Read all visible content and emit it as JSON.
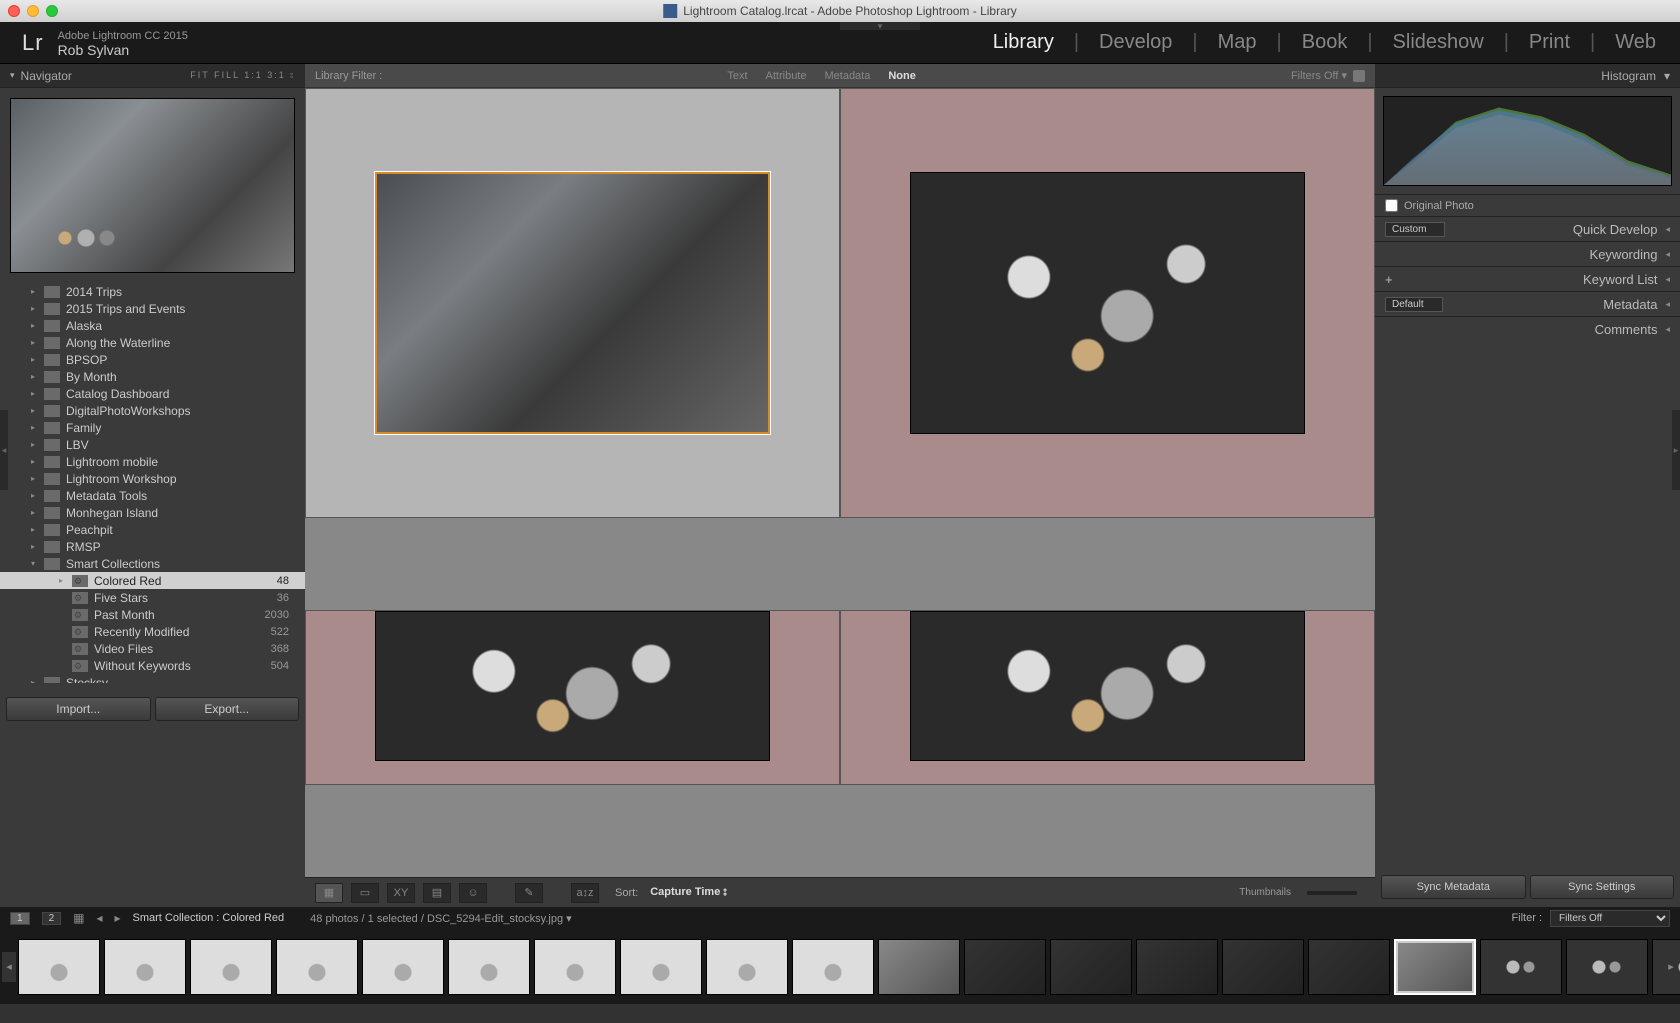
{
  "window": {
    "title": "Lightroom Catalog.lrcat - Adobe Photoshop Lightroom - Library"
  },
  "identity": {
    "product": "Adobe Lightroom CC 2015",
    "user": "Rob Sylvan",
    "logo": "Lr"
  },
  "modules": {
    "items": [
      "Library",
      "Develop",
      "Map",
      "Book",
      "Slideshow",
      "Print",
      "Web"
    ],
    "active": "Library"
  },
  "navigator": {
    "title": "Navigator",
    "zoom_modes": "FIT   FILL   1:1   3:1 ⦂"
  },
  "tree": {
    "items": [
      {
        "label": "2014 Trips"
      },
      {
        "label": "2015 Trips and Events"
      },
      {
        "label": "Alaska"
      },
      {
        "label": "Along the Waterline"
      },
      {
        "label": "BPSOP"
      },
      {
        "label": "By Month"
      },
      {
        "label": "Catalog Dashboard"
      },
      {
        "label": "DigitalPhotoWorkshops"
      },
      {
        "label": "Family"
      },
      {
        "label": "LBV"
      },
      {
        "label": "Lightroom mobile"
      },
      {
        "label": "Lightroom Workshop"
      },
      {
        "label": "Metadata Tools"
      },
      {
        "label": "Monhegan Island"
      },
      {
        "label": "Peachpit"
      },
      {
        "label": "RMSP"
      }
    ],
    "smart": {
      "label": "Smart Collections",
      "children": [
        {
          "label": "Colored Red",
          "count": "48",
          "selected": true
        },
        {
          "label": "Five Stars",
          "count": "36"
        },
        {
          "label": "Past Month",
          "count": "2030"
        },
        {
          "label": "Recently Modified",
          "count": "522"
        },
        {
          "label": "Video Files",
          "count": "368"
        },
        {
          "label": "Without Keywords",
          "count": "504"
        }
      ]
    },
    "last": {
      "label": "Stocksy"
    }
  },
  "impexp": {
    "import": "Import...",
    "export": "Export..."
  },
  "filterbar": {
    "label": "Library Filter :",
    "types": [
      "Text",
      "Attribute",
      "Metadata",
      "None"
    ],
    "active": "None",
    "filters_off": "Filters Off ▾"
  },
  "toolbar": {
    "sort_label": "Sort:",
    "sort_value": "Capture Time",
    "thumbnails": "Thumbnails"
  },
  "right": {
    "histogram": "Histogram",
    "original": "Original Photo",
    "quickdev_dd": "Custom",
    "quickdev": "Quick Develop",
    "keywording": "Keywording",
    "keywordlist": "Keyword List",
    "keywordlist_plus": "+",
    "metadata_dd": "Default",
    "metadata": "Metadata",
    "comments": "Comments",
    "sync_meta": "Sync Metadata",
    "sync_settings": "Sync Settings"
  },
  "secondary": {
    "screens": [
      "1",
      "2"
    ],
    "crumb": "Smart Collection : Colored Red",
    "status": "48 photos / 1 selected / DSC_5294-Edit_stocksy.jpg ▾",
    "filter_label": "Filter :",
    "filter_value": "Filters Off"
  }
}
